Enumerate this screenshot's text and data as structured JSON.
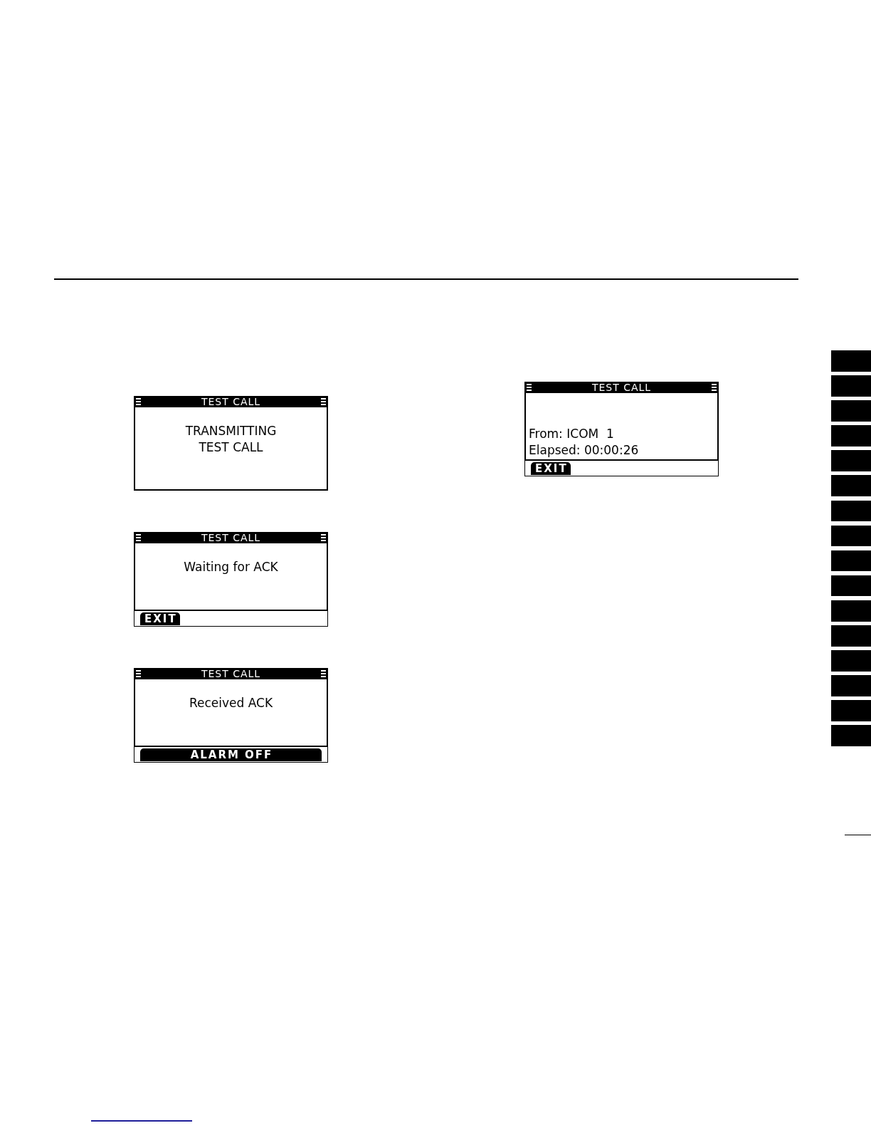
{
  "columns": [
    {
      "screens": [
        {
          "kind": "message",
          "title": "TEST CALL",
          "lines": [
            "TRANSMITTING",
            "TEST CALL"
          ]
        },
        {
          "kind": "message",
          "title": "TEST CALL",
          "lines": [
            "Waiting for ACK"
          ],
          "softkeys": [
            {
              "label": "EXIT",
              "kind": "slot"
            }
          ]
        },
        {
          "kind": "message",
          "title": "TEST CALL",
          "lines": [
            "Received ACK"
          ],
          "softkeys": [
            {
              "label": "ALARM OFF",
              "kind": "full"
            }
          ]
        }
      ]
    },
    {
      "screens": [
        {
          "kind": "status",
          "title": "TEST CALL",
          "lines": [
            "From: ICOM  1",
            "Elapsed: 00:00:26"
          ],
          "softkeys": [
            {
              "label": "EXIT",
              "kind": "slot"
            }
          ]
        }
      ]
    }
  ]
}
